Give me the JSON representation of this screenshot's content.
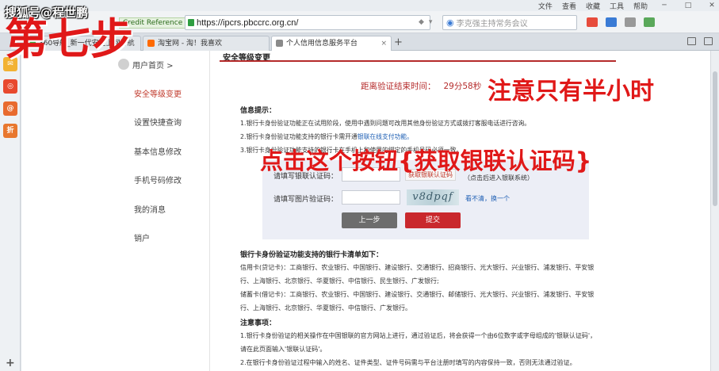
{
  "browser": {
    "title_small": "360安全浏览器 7.1",
    "menu": [
      "文件",
      "查看",
      "收藏",
      "工具",
      "帮助"
    ],
    "window_controls": [
      "─",
      "□",
      "✕"
    ],
    "extension_tag": "Credit Reference Center",
    "url": "https://ipcrs.pbccrc.org.cn/",
    "search_placeholder": "李克强主持常务会议",
    "tabs": [
      {
        "label": "360导航_新一代安全上网导航"
      },
      {
        "label": "淘宝网 - 淘！我喜欢"
      },
      {
        "label": "个人信用信息服务平台",
        "active": true
      }
    ],
    "new_tab": "+",
    "left_icons": [
      {
        "name": "mail-icon",
        "text": "✉",
        "color": "#f2b233"
      },
      {
        "name": "weibo-icon",
        "text": "◎",
        "color": "#e8492e"
      },
      {
        "name": "at-icon",
        "text": "@",
        "color": "#e86a2e"
      },
      {
        "name": "discount-icon",
        "text": "折",
        "color": "#e8772e"
      }
    ],
    "add_icon": "+"
  },
  "sidenav": {
    "top_label": "用户首页 >",
    "items": [
      {
        "label": "安全等级变更",
        "active": true
      },
      {
        "label": "设置快捷查询"
      },
      {
        "label": "基本信息修改"
      },
      {
        "label": "手机号码修改"
      },
      {
        "label": "我的消息"
      },
      {
        "label": "销户"
      }
    ]
  },
  "main": {
    "section_title": "安全等级变更",
    "timer_label": "距离验证结束时间：",
    "timer_value": "29分58秒",
    "info_heading": "信息提示：",
    "info_lines": [
      "1.银行卡身份验证功能正在试用阶段，使用中遇到问题可改用其他身份验证方式或拨打客服电话进行咨询。",
      "2.银行卡身份验证功能支持的银行卡需开通",
      "3.银行卡身份验证功能支持的银行卡在手机上和使用的绑定的手机号码必须一致。"
    ],
    "info_link": "银联在线支付功能。",
    "form": {
      "bank_code_label": "请填写银联认证码：",
      "get_code_button": "获取银联认证码",
      "get_code_note": "（点击后进入银联系统）",
      "captcha_label": "请填写图片验证码：",
      "captcha_text": "v8dpqf",
      "refresh_link": "看不清，换一个",
      "prev_button": "上一步",
      "submit_button": "提交"
    },
    "bank_heading": "银行卡身份验证功能支持的银行卡清单如下：",
    "bank_lines": [
      "信用卡(贷记卡)：工商银行、农业银行、中国银行、建设银行、交通银行、招商银行、光大银行、兴业银行、浦发银行、平安银",
      "行、上海银行、北京银行、华夏银行、中信银行、民生银行、广发银行;",
      "储蓄卡(借记卡)：工商银行、农业银行、中国银行、建设银行、交通银行、邮储银行、光大银行、兴业银行、浦发银行、平安银",
      "行、上海银行、北京银行、华夏银行、中信银行、广发银行。"
    ],
    "notes_heading": "注意事项：",
    "notes_lines": [
      "1.银行卡身份验证的相关操作在中国银联的官方网站上进行，通过验证后，将会获得一个由6位数字或字母组成的'银联认证码'，",
      "请在此页面输入'银联认证码'。",
      "2.在银行卡身份验证过程中输入的姓名、证件类型、证件号码需与平台注册时填写的内容保持一致，否则无法通过验证。"
    ]
  },
  "overlays": {
    "brand": "搜狐号@程世鹏",
    "step": "第七步",
    "half_hour": "注意只有半小时",
    "click_hint": "点击这个按钮{获取银联认证码}"
  }
}
